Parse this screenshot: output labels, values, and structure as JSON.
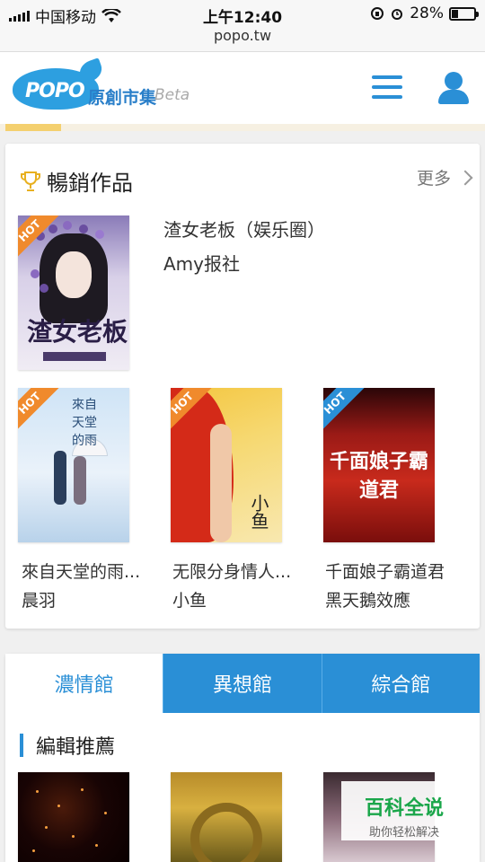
{
  "status_bar": {
    "carrier": "中国移动",
    "time": "上午12:40",
    "battery_text": "28%",
    "battery_level": 0.28,
    "icons": [
      "signal-icon",
      "wifi-icon",
      "orientation-lock-icon",
      "alarm-icon",
      "battery-icon"
    ]
  },
  "browser": {
    "url": "popo.tw"
  },
  "header": {
    "logo_word": "POPO",
    "logo_cn": "原創市集",
    "logo_beta": "Beta",
    "menu_icon": "hamburger-menu-icon",
    "user_icon": "user-icon",
    "brand_color": "#2a8fd6"
  },
  "best_sellers": {
    "title": "暢銷作品",
    "more_label": "更多",
    "trophy_icon": "trophy-icon",
    "featured": {
      "title": "渣女老板（娱乐圈）",
      "author": "Amy报社",
      "cover_text": "渣女老板",
      "badge": "HOT"
    },
    "books": [
      {
        "title": "來自天堂的雨...",
        "author": "晨羽",
        "badge": "HOT",
        "cover_text": "來自天堂的雨"
      },
      {
        "title": "无限分身情人...",
        "author": "小鱼",
        "badge": "HOT",
        "cover_text": "小鱼"
      },
      {
        "title": "千面娘子霸道君",
        "author": "黑天鵝效應",
        "badge": "HOT",
        "cover_text": "千面娘子霸道君"
      }
    ]
  },
  "tabs": {
    "items": [
      {
        "label": "濃情館",
        "active": true
      },
      {
        "label": "異想館",
        "active": false
      },
      {
        "label": "綜合館",
        "active": false
      }
    ]
  },
  "editor_picks": {
    "title": "編輯推薦"
  },
  "watermark": {
    "main": "百科全说",
    "sub": "助你轻松解决"
  }
}
